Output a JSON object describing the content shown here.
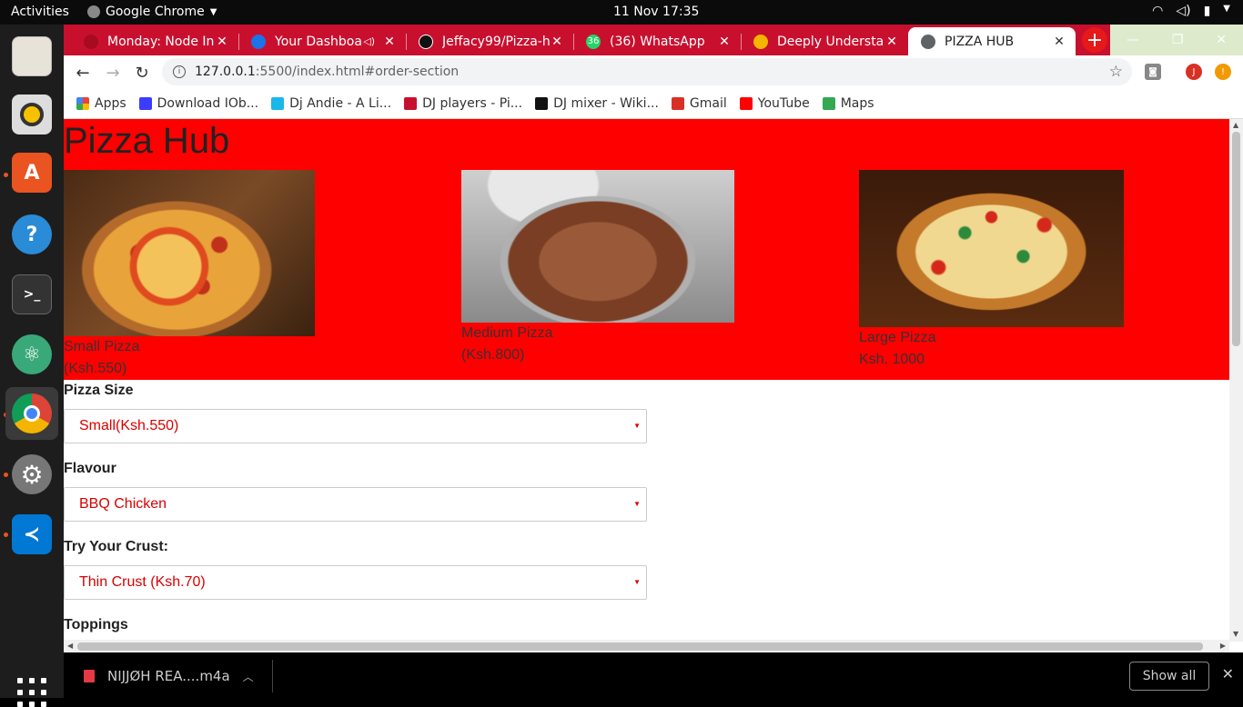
{
  "os": {
    "activities": "Activities",
    "app_name": "Google Chrome",
    "clock": "11 Nov  17:35"
  },
  "browser": {
    "tabs": [
      {
        "title": "Monday: Node In",
        "favicon_color": "#c8102e"
      },
      {
        "title": "Your Dashboa",
        "favicon_color": "#1a73e8"
      },
      {
        "title": "Jeffacy99/Pizza-h",
        "favicon_color": "#111111"
      },
      {
        "title": "(36) WhatsApp",
        "favicon_color": "#25d366"
      },
      {
        "title": "Deeply Understa",
        "favicon_color": "#f4b400"
      },
      {
        "title": "PIZZA HUB",
        "favicon_color": "#5f6368"
      }
    ],
    "url_host": "127.0.0.1",
    "url_rest": ":5500/index.html#order-section",
    "profile_initial": "J",
    "bookmarks": [
      {
        "label": "Apps",
        "color": "#4285f4"
      },
      {
        "label": "Download IOb...",
        "color": "#3c3cff"
      },
      {
        "label": "Dj Andie - A Li...",
        "color": "#1ab7ea"
      },
      {
        "label": "DJ players - Pi...",
        "color": "#c8102e"
      },
      {
        "label": "DJ mixer - Wiki...",
        "color": "#111111"
      },
      {
        "label": "Gmail",
        "color": "#d93025"
      },
      {
        "label": "YouTube",
        "color": "#ff0000"
      },
      {
        "label": "Maps",
        "color": "#34a853"
      }
    ]
  },
  "page": {
    "title": "Pizza Hub",
    "pizzas": [
      {
        "name": "Small Pizza",
        "price": "(Ksh.550)"
      },
      {
        "name": "Medium Pizza",
        "price": "(Ksh.800)"
      },
      {
        "name": "Large Pizza",
        "price": "Ksh. 1000"
      }
    ],
    "fields": [
      {
        "label": "Pizza Size",
        "value": "Small(Ksh.550)"
      },
      {
        "label": "Flavour",
        "value": "BBQ Chicken"
      },
      {
        "label": "Try Your Crust:",
        "value": "Thin Crust (Ksh.70)"
      }
    ],
    "toppings_label": "Toppings",
    "accent_color": "#ff0000"
  },
  "downloads": {
    "file": "NIJJØH REA....m4a",
    "show_all": "Show all"
  }
}
